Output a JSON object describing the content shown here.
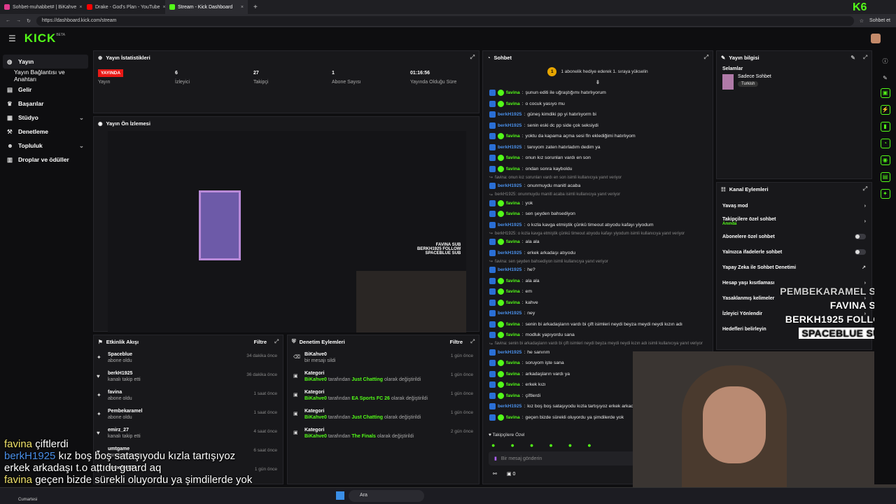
{
  "browser": {
    "tabs": [
      {
        "label": "Sohbet-muhabbet# | BiKahve",
        "color": "#e03a8c"
      },
      {
        "label": "Drake - God's Plan - YouTube",
        "color": "#ff0000"
      },
      {
        "label": "Stream - Kick Dashboard",
        "color": "#53fc18"
      }
    ],
    "new_tab": "+",
    "url": "https://dashboard.kick.com/stream",
    "profile_label": "Sohbet et"
  },
  "brand": {
    "logo": "KICK",
    "beta": "BETA",
    "corner_badge": "K6"
  },
  "sidebar": {
    "items": [
      {
        "label": "Yayın",
        "icon": "broadcast-icon"
      },
      {
        "label": "Yayın Bağlantısı ve Anahtarı",
        "icon": ""
      },
      {
        "label": "Gelir",
        "icon": "wallet-icon"
      },
      {
        "label": "Başarılar",
        "icon": "trophy-icon"
      },
      {
        "label": "Stüdyo",
        "icon": "studio-icon"
      },
      {
        "label": "Denetleme",
        "icon": "hammer-icon"
      },
      {
        "label": "Topluluk",
        "icon": "community-icon"
      },
      {
        "label": "Droplar ve ödüller",
        "icon": "gift-icon"
      }
    ]
  },
  "stats": {
    "title": "Yayın İstatistikleri",
    "live_badge": "YAYINDA",
    "live_label": "Yayın",
    "viewers": "6",
    "viewers_label": "İzleyici",
    "followers": "27",
    "followers_label": "Takipçi",
    "subs": "1",
    "subs_label": "Abone Sayısı",
    "uptime": "01:16:56",
    "uptime_label": "Yayında Olduğu Süre"
  },
  "preview": {
    "title": "Yayın Ön İzlemesi"
  },
  "activity": {
    "title": "Etkinlik Akışı",
    "filter": "Filtre",
    "items": [
      {
        "name": "Spaceblue",
        "desc": "abone oldu",
        "time": "34 dakika önce",
        "icon": "star-icon"
      },
      {
        "name": "berkH1925",
        "desc": "kanalı takip etti",
        "time": "36 dakika önce",
        "icon": "heart-icon"
      },
      {
        "name": "favina",
        "desc": "abone oldu",
        "time": "1 saat önce",
        "icon": "star-icon"
      },
      {
        "name": "Pembekaramel",
        "desc": "abone oldu",
        "time": "1 saat önce",
        "icon": "star-icon"
      },
      {
        "name": "emirz_27",
        "desc": "kanalı takip etti",
        "time": "4 saat önce",
        "icon": "heart-icon"
      },
      {
        "name": "umtgame",
        "desc": "kanalı takip etti",
        "time": "6 saat önce",
        "icon": "heart-icon"
      },
      {
        "name": "sarpefe4523",
        "desc": "",
        "time": "1 gün önce",
        "icon": "heart-icon"
      }
    ]
  },
  "moderation": {
    "title": "Denetim Eylemleri",
    "filter": "Filtre",
    "items": [
      {
        "title": "BiKahve0",
        "by": "",
        "a": "bir mesajı sildi",
        "b": "",
        "c": "",
        "time": "1 gün önce",
        "icon": "trash-icon"
      },
      {
        "title": "Kategori",
        "by": "BiKahve0",
        "a": " tarafından ",
        "b": "Just Chatting",
        "c": " olarak değiştirildi",
        "time": "1 gün önce",
        "icon": "category-icon"
      },
      {
        "title": "Kategori",
        "by": "BiKahve0",
        "a": " tarafından ",
        "b": "EA Sports FC 26",
        "c": " olarak değiştirildi",
        "time": "1 gün önce",
        "icon": "category-icon"
      },
      {
        "title": "Kategori",
        "by": "BiKahve0",
        "a": " tarafından ",
        "b": "Just Chatting",
        "c": " olarak değiştirildi",
        "time": "1 gün önce",
        "icon": "category-icon"
      },
      {
        "title": "Kategori",
        "by": "BiKahve0",
        "a": " tarafından ",
        "b": "The Finals",
        "c": " olarak değiştirildi",
        "time": "2 gün önce",
        "icon": "category-icon"
      }
    ]
  },
  "chat": {
    "title": "Sohbet",
    "gift_text": "1 abonelik hediye ederek 1. sıraya yükselin",
    "gift_count": "1",
    "input_placeholder": "Bir mesaj gönderin",
    "followers_only": "Takipçilere Özel",
    "footer_count": "0",
    "messages": [
      {
        "u": "favina",
        "t": "şunun editi ile uğraştığımı hatırlıyorum",
        "c": "g"
      },
      {
        "u": "favina",
        "t": "o cocuk yasıyo mu",
        "c": "g"
      },
      {
        "u": "berkH1925",
        "t": "güneş kimdiki pp yi hatırlıyorm bi",
        "c": "b"
      },
      {
        "u": "berkH1925",
        "t": "senin eski dc pp side çok seksiydi",
        "c": "b"
      },
      {
        "u": "favina",
        "t": "yoktu da kapama açma sesi fln eklediğimi hatırlıyom",
        "c": "g"
      },
      {
        "u": "berkH1925",
        "t": "tanıyom zaten hatırladım dedim ya",
        "c": "b"
      },
      {
        "u": "favina",
        "t": "onun kız sorunları vardı en son",
        "c": "g"
      },
      {
        "u": "favina",
        "t": "ondan sonra kayboldu",
        "c": "g"
      },
      {
        "r": "favina: onun kız sorunları vardı en son isimli kullanıcıya yanıt veriyor"
      },
      {
        "u": "berkH1925",
        "t": "onunmuydu manitl acaba",
        "c": "b"
      },
      {
        "r": "berkH1925: onunmuydu manitl acaba isimli kullanıcıya yanıt veriyor"
      },
      {
        "u": "favina",
        "t": "yok",
        "c": "g"
      },
      {
        "u": "favina",
        "t": "sen şeyden bahsediyon",
        "c": "g"
      },
      {
        "u": "berkH1925",
        "t": "o kızla kavga etmiştik çünkü timeout atıyodu kafayı yiyodum",
        "c": "b"
      },
      {
        "r": "berkH1925: o kızla kavga etmiştik çünkü timeout atıyodu kafayı yiyodum isimli kullanıcıya yanıt veriyor"
      },
      {
        "u": "favina",
        "t": "ala ala",
        "c": "g"
      },
      {
        "u": "berkH1925",
        "t": "erkek arkadaşı atıyodu",
        "c": "b"
      },
      {
        "r": "favina: sen şeyden bahsediyon isimli kullanıcıya yanıt veriyor"
      },
      {
        "u": "berkH1925",
        "t": "he?",
        "c": "b"
      },
      {
        "u": "favina",
        "t": "ala ala",
        "c": "g"
      },
      {
        "u": "favina",
        "t": "em",
        "c": "g"
      },
      {
        "u": "favina",
        "t": "kahve",
        "c": "g"
      },
      {
        "u": "berkH1925",
        "t": "ney",
        "c": "b"
      },
      {
        "u": "favina",
        "t": "senin bi arkadaşların vardı bi çift isimleri neydi beyza meydi neydi kızın adı",
        "c": "g"
      },
      {
        "u": "favina",
        "t": "modluk yapıyordu sana",
        "c": "g"
      },
      {
        "r": "favina: senin bi arkadaşların vardı bi çift isimleri neydi beyza meydi neydi kızın adı isimli kullanıcıya yanıt veriyor"
      },
      {
        "u": "berkH1925",
        "t": "he sanırım",
        "c": "b"
      },
      {
        "u": "favina",
        "t": "soruyom işte sana",
        "c": "g"
      },
      {
        "u": "favina",
        "t": "arkadaşların vardı ya",
        "c": "g"
      },
      {
        "u": "favina",
        "t": "erkek kızı",
        "c": "g"
      },
      {
        "u": "favina",
        "t": "çiftlerdi",
        "c": "g"
      },
      {
        "u": "berkH1925",
        "t": "kız boş boş sataşıyodu kızla tartışıyoz erkek arkadaşı",
        "c": "b"
      },
      {
        "u": "favina",
        "t": "geçen bizde sürekli oluyordu ya şimdilerde yok",
        "c": "g"
      }
    ]
  },
  "stream_info": {
    "title": "Yayın bilgisi",
    "stream_title": "Selamlar",
    "category": "Sadece Sohbet",
    "language": "Turkish"
  },
  "channel_actions": {
    "title": "Kanal Eylemleri",
    "items": [
      {
        "label": "Yavaş mod",
        "sub": "",
        "ctrl": "arrow"
      },
      {
        "label": "Takipçilere özel sohbet",
        "sub": "Anında",
        "ctrl": "arrow"
      },
      {
        "label": "Abonelere özel sohbet",
        "sub": "",
        "ctrl": "toggle"
      },
      {
        "label": "Yalnızca ifadelerle sohbet",
        "sub": "",
        "ctrl": "toggle"
      },
      {
        "label": "Yapay Zeka ile Sohbet Denetimi",
        "sub": "",
        "ctrl": "external"
      },
      {
        "label": "Hesap yaşı kısıtlaması",
        "sub": "",
        "ctrl": "arrow"
      },
      {
        "label": "Yasaklanmış kelimeler",
        "sub": "",
        "ctrl": "arrow"
      },
      {
        "label": "İzleyici Yönlendir",
        "sub": "",
        "ctrl": "arrow"
      },
      {
        "label": "Hedefleri belirleyin",
        "sub": "",
        "ctrl": "arrow"
      }
    ]
  },
  "overlay_alerts": [
    {
      "name": "PEMBEKARAMEL",
      "type": "SUB"
    },
    {
      "name": "FAVINA",
      "type": "SUB"
    },
    {
      "name": "BERKH1925",
      "type": "FOLLOW"
    },
    {
      "name": "SPACEBLUE",
      "type": "SUB"
    }
  ],
  "captions": [
    {
      "user": "favina",
      "text": "çiftlerdi"
    },
    {
      "user": "berkH1925",
      "text": "kız boş boş sataşıyodu kızla tartışıyoz"
    },
    {
      "user": "",
      "text": "erkek arkadaşı t.o attıdu guard aq"
    },
    {
      "user": "favina",
      "text": "geçen bizde sürekli oluyordu ya şimdilerde yok"
    }
  ],
  "taskbar": {
    "search": "Ara",
    "day": "Cumartesi"
  }
}
